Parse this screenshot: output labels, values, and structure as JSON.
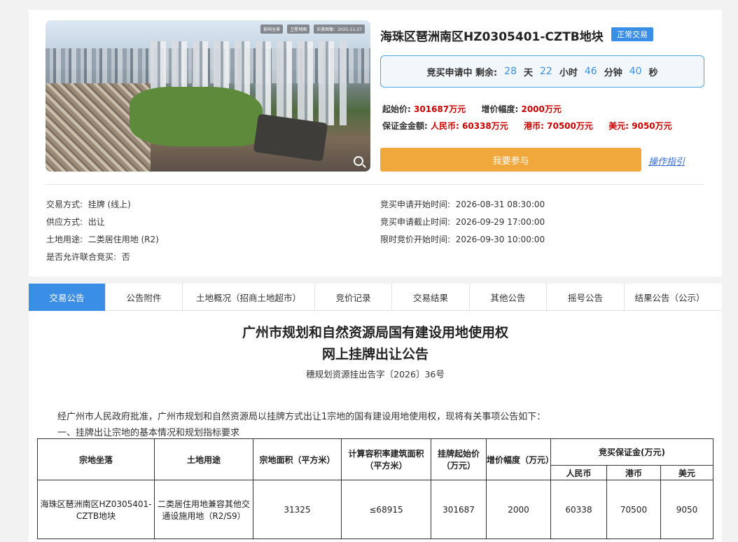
{
  "parcel": {
    "photo_labels": [
      "影响全景",
      "卫星地图",
      "实景图像：2025-11-27"
    ],
    "title": "海珠区琶洲南区HZ0305401-CZTB地块",
    "status": "正常交易"
  },
  "countdown": {
    "label": "竞买申请中  剩余:",
    "days": "28",
    "days_unit": "天",
    "hours": "22",
    "hours_unit": "小时",
    "minutes": "46",
    "minutes_unit": "分钟",
    "seconds": "40",
    "seconds_unit": "秒"
  },
  "pricing": {
    "start_label": "起始价:",
    "start_value": "301687万元",
    "increment_label": "增价幅度:",
    "increment_value": "2000万元",
    "deposit_label": "保证金金额:",
    "cny_label": "人民币:",
    "cny_value": "60338万元",
    "hkd_label": "港币:",
    "hkd_value": "70500万元",
    "usd_label": "美元:",
    "usd_value": "9050万元"
  },
  "actions": {
    "join_label": "我要参与",
    "guide_label": "操作指引"
  },
  "info_left": [
    {
      "label": "交易方式:",
      "value": "挂牌  (线上)"
    },
    {
      "label": "供应方式:",
      "value": "出让"
    },
    {
      "label": "土地用途:",
      "value": "二类居住用地 (R2)"
    },
    {
      "label": "是否允许联合竞买:",
      "value": "否"
    }
  ],
  "info_right": [
    {
      "label": "竞买申请开始时间:",
      "value": "2026-08-31 08:30:00"
    },
    {
      "label": "竞买申请截止时间:",
      "value": "2026-09-29 17:00:00"
    },
    {
      "label": "限时竞价开始时间:",
      "value": "2026-09-30 10:00:00"
    }
  ],
  "tabs": [
    "交易公告",
    "公告附件",
    "土地概况（招商土地超市）",
    "竞价记录",
    "交易结果",
    "其他公告",
    "摇号公告",
    "结果公告（公示）"
  ],
  "notice": {
    "title_line1": "广州市规划和自然资源局国有建设用地使用权",
    "title_line2": "网上挂牌出让公告",
    "doc_no": "穗规划资源挂出告字〔2026〕36号",
    "intro": "经广州市人民政府批准，广州市规划和自然资源局以挂牌方式出让1宗地的国有建设用地使用权，现将有关事项公告如下：",
    "section1": "一、挂牌出让宗地的基本情况和规划指标要求"
  },
  "table": {
    "h_location": "宗地坐落",
    "h_use": "土地用途",
    "h_area": "宗地面积（平方米）",
    "h_far": "计算容积率建筑面积（平方米）",
    "h_start": "挂牌起始价（万元）",
    "h_inc": "增价幅度（万元）",
    "h_deposit": "竞买保证金(万元)",
    "h_cny": "人民币",
    "h_hkd": "港币",
    "h_usd": "美元",
    "row": {
      "location": "海珠区琶洲南区HZ0305401-CZTB地块",
      "use": "二类居住用地兼容其他交通设施用地（R2/S9）",
      "area": "31325",
      "far": "≤68915",
      "start": "301687",
      "inc": "2000",
      "cny": "60338",
      "hkd": "70500",
      "usd": "9050"
    }
  }
}
